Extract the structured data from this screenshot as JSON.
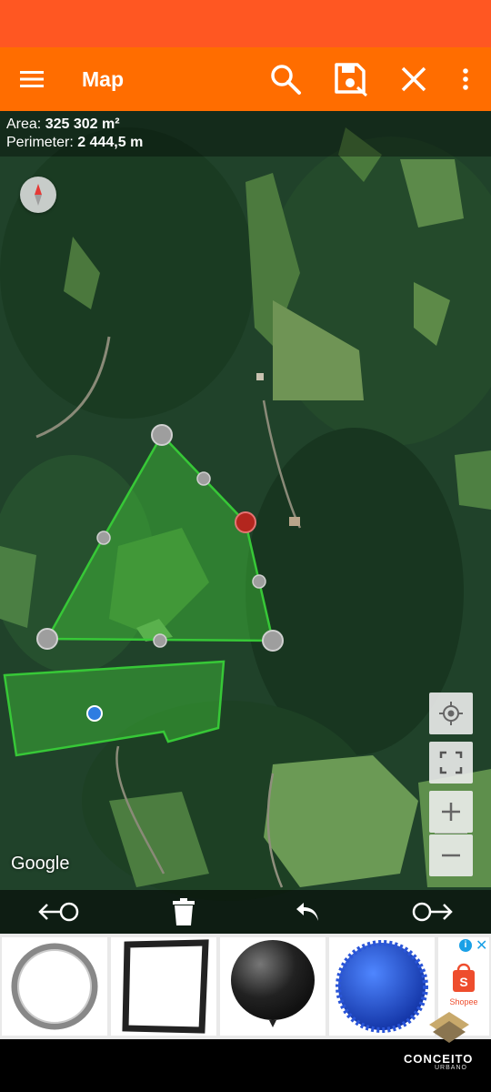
{
  "app_bar": {
    "title": "Map",
    "icons": [
      "menu-icon",
      "search-icon",
      "save-icon",
      "close-icon",
      "more-vert-icon"
    ]
  },
  "measure": {
    "area_label": "Area:",
    "area_value": "325 302 m²",
    "perimeter_label": "Perimeter:",
    "perimeter_value": "2 444,5 m"
  },
  "map": {
    "attribution": "Google",
    "polygon_color": "#37c837",
    "vertex_selected_color": "#c62828",
    "location_dot_color": "#2f7de1",
    "controls": [
      "my-location-icon",
      "fullscreen-icon",
      "zoom-in-icon",
      "zoom-out-icon"
    ]
  },
  "bottom_toolbar": {
    "icons": [
      "previous-vertex-icon",
      "delete-icon",
      "undo-icon",
      "next-vertex-icon"
    ]
  },
  "ad": {
    "brand": "Shopee",
    "products": [
      "ring-product",
      "frame-product",
      "balloon-product",
      "massage-ball-product"
    ]
  },
  "watermark": {
    "name": "CONCEITO",
    "subtitle": "URBANO"
  },
  "colors": {
    "status_bar": "#ff5722",
    "app_bar": "#ff6d00"
  }
}
